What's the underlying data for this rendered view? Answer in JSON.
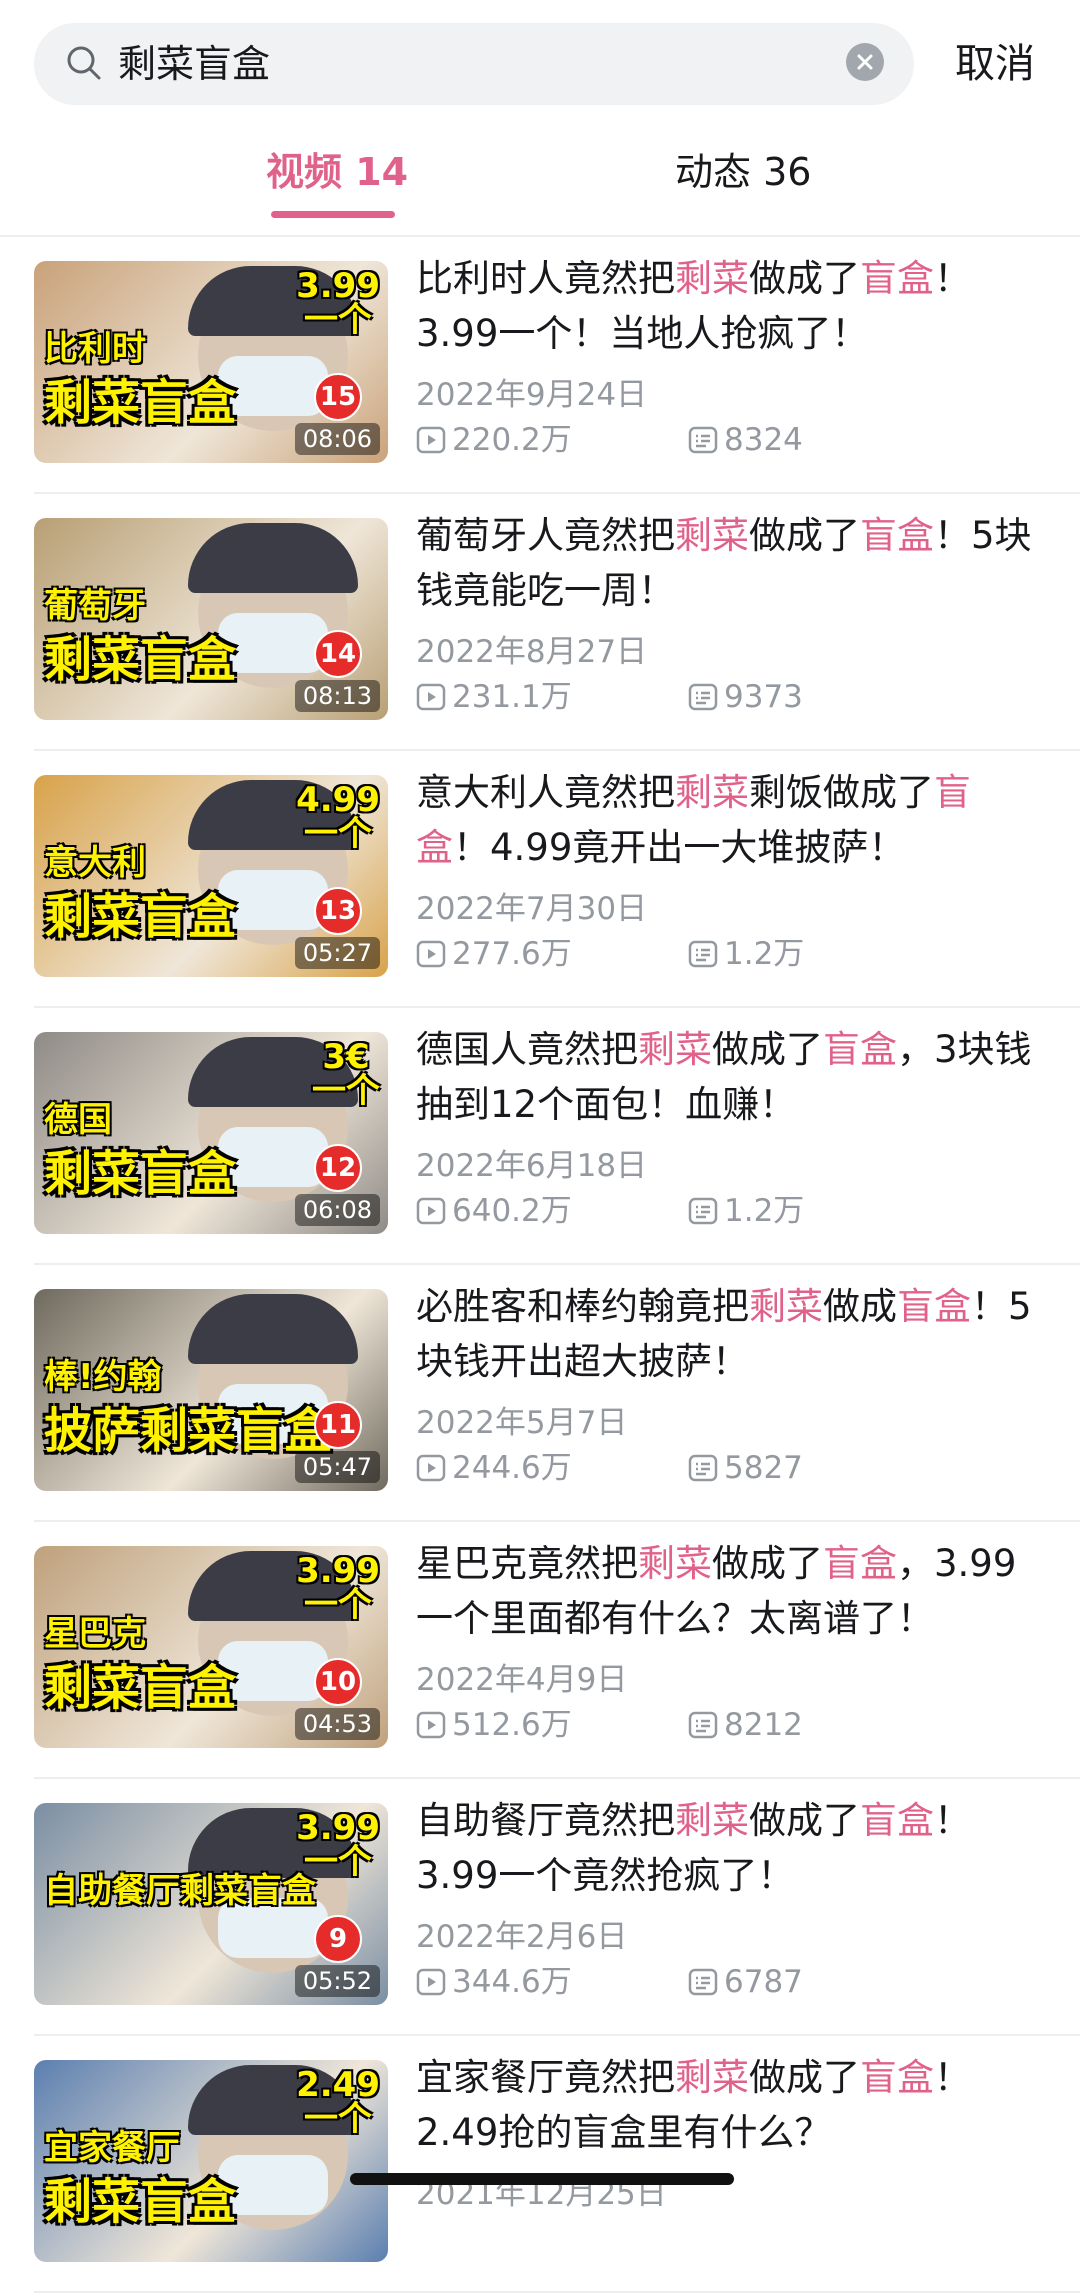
{
  "search": {
    "query": "剩菜盲盒",
    "cancel_label": "取消"
  },
  "tabs": [
    {
      "label": "视频 14",
      "active": true
    },
    {
      "label": "动态 36",
      "active": false
    }
  ],
  "colors": {
    "accent": "#e0628a",
    "meta": "#9499a0"
  },
  "items": [
    {
      "title_parts": [
        "比利时人竟然把",
        "剩菜",
        "做成了",
        "盲盒",
        "！3.99一个！当地人抢疯了！"
      ],
      "date": "2022年9月24日",
      "views": "220.2万",
      "danmaku": "8324",
      "thumb": {
        "top": "比利时",
        "main": "剩菜盲盒",
        "price": "3.99\n一个",
        "badge": "15",
        "duration": "08:06",
        "bg": "#c9a27a"
      }
    },
    {
      "title_parts": [
        "葡萄牙人竟然把",
        "剩菜",
        "做成了",
        "盲盒",
        "！5块钱竟能吃一周！"
      ],
      "date": "2022年8月27日",
      "views": "231.1万",
      "danmaku": "9373",
      "thumb": {
        "top": "葡萄牙",
        "main": "剩菜盲盒",
        "price": "",
        "badge": "14",
        "duration": "08:13",
        "bg": "#b89f74"
      }
    },
    {
      "title_parts": [
        "意大利人竟然把",
        "剩菜",
        "剩饭做成了",
        "盲盒",
        "！4.99竟开出一大堆披萨！"
      ],
      "date": "2022年7月30日",
      "views": "277.6万",
      "danmaku": "1.2万",
      "thumb": {
        "top": "意大利",
        "main": "剩菜盲盒",
        "price": "4.99\n一个",
        "badge": "13",
        "duration": "05:27",
        "bg": "#d8a24a"
      }
    },
    {
      "title_parts": [
        "德国人竟然把",
        "剩菜",
        "做成了",
        "盲盒",
        "，3块钱抽到12个面包！血赚！"
      ],
      "date": "2022年6月18日",
      "views": "640.2万",
      "danmaku": "1.2万",
      "thumb": {
        "top": "德国",
        "main": "剩菜盲盒",
        "price": "3€\n一个",
        "badge": "12",
        "duration": "06:08",
        "bg": "#8e8a86"
      }
    },
    {
      "title_parts": [
        "必胜客和棒约翰竟把",
        "剩菜",
        "做成",
        "盲盒",
        "！5块钱开出超大披萨！"
      ],
      "date": "2022年5月7日",
      "views": "244.6万",
      "danmaku": "5827",
      "thumb": {
        "top": "棒!约翰",
        "main": "披萨剩菜盲盒",
        "price": "",
        "badge": "11",
        "duration": "05:47",
        "bg": "#6f6a5e"
      }
    },
    {
      "title_parts": [
        "星巴克竟然把",
        "剩菜",
        "做成了",
        "盲盒",
        "，3.99一个里面都有什么？太离谱了！"
      ],
      "date": "2022年4月9日",
      "views": "512.6万",
      "danmaku": "8212",
      "thumb": {
        "top": "星巴克",
        "main": "剩菜盲盒",
        "price": "3.99\n一个",
        "badge": "10",
        "duration": "04:53",
        "bg": "#bfa17c"
      }
    },
    {
      "title_parts": [
        "自助餐厅竟然把",
        "剩菜",
        "做成了",
        "盲盒",
        "！3.99一个竟然抢疯了！"
      ],
      "date": "2022年2月6日",
      "views": "344.6万",
      "danmaku": "6787",
      "thumb": {
        "top": "自助餐厅剩菜盲盒",
        "main": "",
        "price": "3.99\n一个",
        "badge": "9",
        "duration": "05:52",
        "bg": "#7a8ea3"
      }
    },
    {
      "title_parts": [
        "宜家餐厅竟然把",
        "剩菜",
        "做成了",
        "盲盒",
        "！2.49抢的盲盒里有什么？"
      ],
      "date": "2021年12月25日",
      "views": "",
      "danmaku": "",
      "thumb": {
        "top": "宜家餐厅",
        "main": "剩菜盲盒",
        "price": "2.49\n一个",
        "badge": "",
        "duration": "",
        "bg": "#5b7fb0"
      }
    }
  ]
}
